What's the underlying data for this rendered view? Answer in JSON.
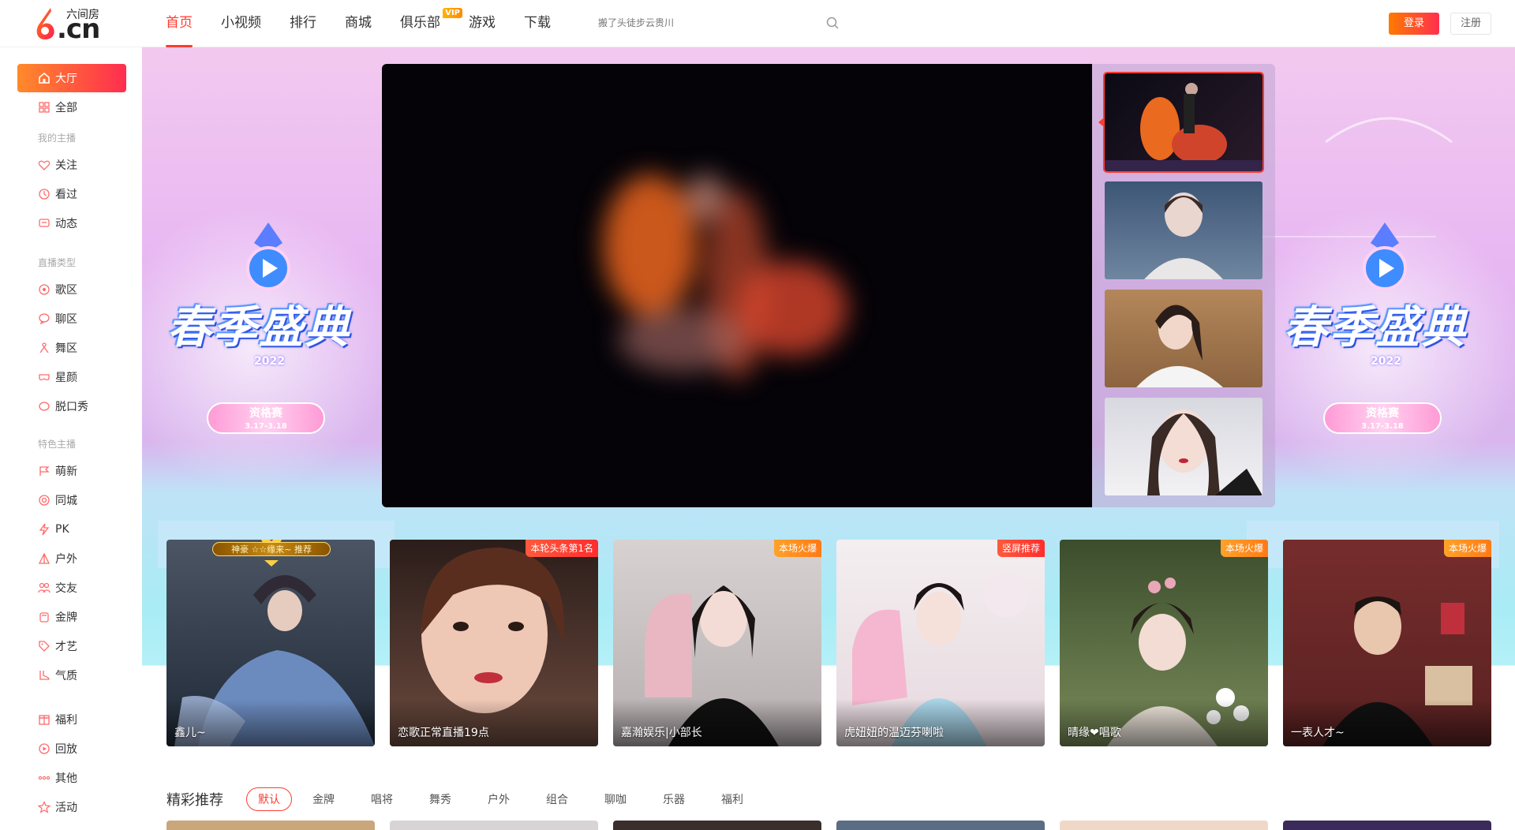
{
  "brand": {
    "logo_sub": "六间房",
    "logo_cn": ".cn"
  },
  "nav": {
    "items": [
      {
        "label": "首页",
        "active": true
      },
      {
        "label": "小视频"
      },
      {
        "label": "排行"
      },
      {
        "label": "商城"
      },
      {
        "label": "俱乐部",
        "badge": "VIP"
      },
      {
        "label": "游戏"
      },
      {
        "label": "下载"
      }
    ]
  },
  "search": {
    "placeholder": "搬了头徒步云贵川"
  },
  "auth": {
    "login": "登录",
    "register": "注册"
  },
  "sidebar": {
    "top": [
      {
        "label": "大厅",
        "active": true,
        "icon": "home-icon"
      },
      {
        "label": "全部",
        "icon": "grid-icon"
      }
    ],
    "group1": {
      "title": "我的主播",
      "items": [
        {
          "label": "关注",
          "icon": "heart-icon"
        },
        {
          "label": "看过",
          "icon": "clock-icon"
        },
        {
          "label": "动态",
          "icon": "chat-icon"
        }
      ]
    },
    "group2": {
      "title": "直播类型",
      "items": [
        {
          "label": "歌区",
          "icon": "music-icon"
        },
        {
          "label": "聊区",
          "icon": "bubble-icon"
        },
        {
          "label": "舞区",
          "icon": "dance-icon"
        },
        {
          "label": "星颜",
          "icon": "mask-icon"
        },
        {
          "label": "脱口秀",
          "icon": "mic-icon"
        }
      ]
    },
    "group3": {
      "title": "特色主播",
      "items": [
        {
          "label": "萌新",
          "icon": "flag-icon"
        },
        {
          "label": "同城",
          "icon": "location-icon"
        },
        {
          "label": "PK",
          "icon": "bolt-icon"
        },
        {
          "label": "户外",
          "icon": "tent-icon"
        },
        {
          "label": "交友",
          "icon": "friends-icon"
        },
        {
          "label": "金牌",
          "icon": "medal-icon"
        },
        {
          "label": "才艺",
          "icon": "tag-icon"
        },
        {
          "label": "气质",
          "icon": "shoe-icon"
        }
      ]
    },
    "group4": {
      "items": [
        {
          "label": "福利",
          "icon": "gift-icon"
        },
        {
          "label": "回放",
          "icon": "replay-icon"
        },
        {
          "label": "其他",
          "icon": "dots-icon"
        },
        {
          "label": "活动",
          "icon": "star-icon"
        }
      ]
    }
  },
  "banner": {
    "event_title": "春季盛典",
    "event_year": "2022",
    "pill_title": "资格赛",
    "pill_date": "3.17-3.18"
  },
  "cards": [
    {
      "name": "鑫儿~",
      "badge": "神豪 ☆☆缘来~ 推荐",
      "tag": ""
    },
    {
      "name": "恋歌正常直播19点",
      "tag": "本轮头条第1名",
      "tag_color": "red"
    },
    {
      "name": "嘉瀚娱乐|小部长",
      "tag": "本场火爆",
      "tag_color": "orange"
    },
    {
      "name": "虎妞妞的温迈芬喇啦",
      "tag": "竖屏推荐",
      "tag_color": "red"
    },
    {
      "name": "晴缘❤唱歌",
      "tag": "本场火爆",
      "tag_color": "orange"
    },
    {
      "name": "一表人才~",
      "tag": "本场火爆",
      "tag_color": "orange"
    }
  ],
  "recommend": {
    "title": "精彩推荐",
    "tabs": [
      "默认",
      "金牌",
      "唱将",
      "舞秀",
      "户外",
      "组合",
      "聊咖",
      "乐器",
      "福利"
    ]
  },
  "colors": {
    "accent": "#ff3b2f",
    "gradient_start": "#ff8a2a",
    "gradient_end": "#ff2d4f"
  }
}
